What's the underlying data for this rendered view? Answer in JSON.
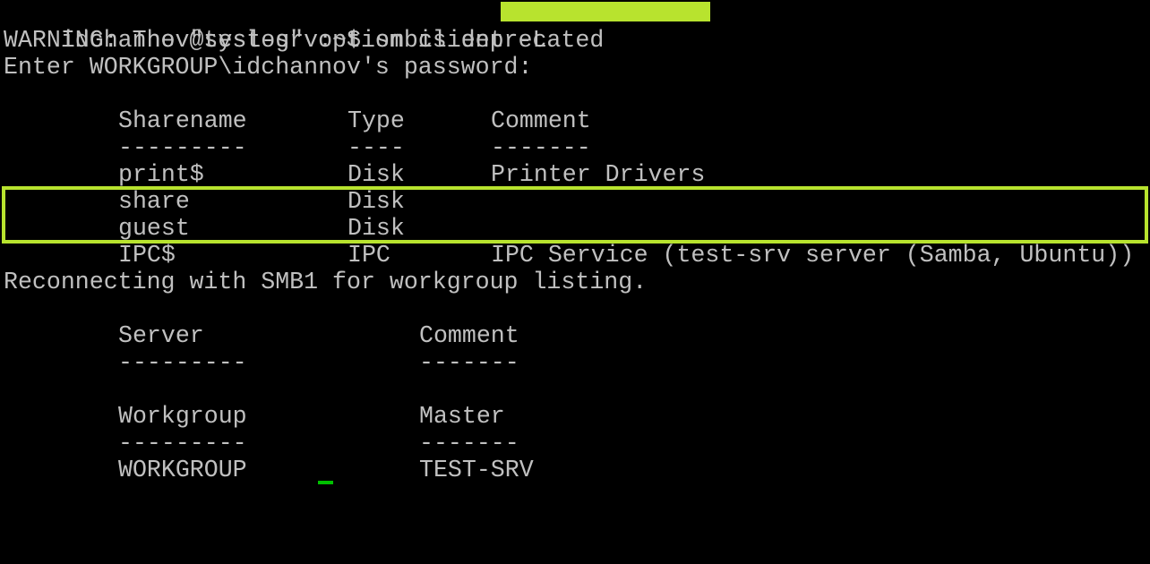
{
  "colors": {
    "background": "#000000",
    "text": "#c0c0c0",
    "highlight": "#b8e32e",
    "redaction": "#b8e32e",
    "cursor": "#00c000"
  },
  "prompt": {
    "text": "idchannov@test-srv:~$ smbclient -L "
  },
  "messages": {
    "warning": "WARNING: The \"syslog\" option is deprecated",
    "password": "Enter WORKGROUP\\idchannov's password:",
    "reconnect": "Reconnecting with SMB1 for workgroup listing."
  },
  "shares_table": {
    "headers": [
      "Sharename",
      "Type",
      "Comment"
    ],
    "separators": [
      "---------",
      "----",
      "-------"
    ],
    "rows": [
      [
        "print$",
        "Disk",
        "Printer Drivers"
      ],
      [
        "share",
        "Disk",
        ""
      ],
      [
        "guest",
        "Disk",
        ""
      ],
      [
        "IPC$",
        "IPC",
        "IPC Service (test-srv server (Samba, Ubuntu))"
      ]
    ]
  },
  "server_table": {
    "headers": [
      "Server",
      "Comment"
    ],
    "separators": [
      "---------",
      "-------"
    ]
  },
  "workgroup_table": {
    "headers": [
      "Workgroup",
      "Master"
    ],
    "separators": [
      "---------",
      "-------"
    ],
    "rows": [
      [
        "WORKGROUP",
        "TEST-SRV"
      ]
    ]
  }
}
